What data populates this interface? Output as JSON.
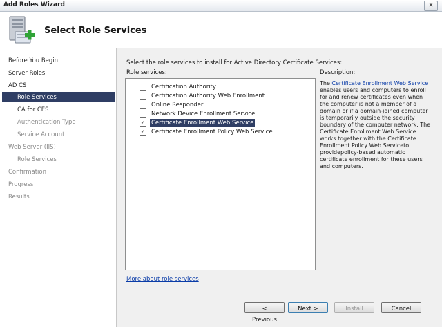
{
  "window": {
    "title": "Add Roles Wizard",
    "close_glyph": "✕"
  },
  "header": {
    "title": "Select Role Services",
    "icon": "server-roles-add-icon"
  },
  "nav": {
    "items": [
      {
        "label": "Before You Begin"
      },
      {
        "label": "Server Roles"
      },
      {
        "label": "AD CS"
      },
      {
        "label": "Role Services"
      },
      {
        "label": "CA for CES"
      },
      {
        "label": "Authentication Type"
      },
      {
        "label": "Service Account"
      },
      {
        "label": "Web Server (IIS)"
      },
      {
        "label": "Role Services"
      },
      {
        "label": "Confirmation"
      },
      {
        "label": "Progress"
      },
      {
        "label": "Results"
      }
    ]
  },
  "main": {
    "instruction": "Select the role services to install for Active Directory Certificate Services:",
    "role_services_label": "Role services:",
    "role_services": [
      {
        "label": "Certification Authority",
        "checked": false
      },
      {
        "label": "Certification Authority Web Enrollment",
        "checked": false
      },
      {
        "label": "Online Responder",
        "checked": false
      },
      {
        "label": "Network Device Enrollment Service",
        "checked": false
      },
      {
        "label": "Certificate Enrollment Web Service",
        "checked": true,
        "selected": true
      },
      {
        "label": "Certificate Enrollment Policy Web Service",
        "checked": true
      }
    ],
    "check_glyph": "✓",
    "description_label": "Description:",
    "description": {
      "prefix": "The ",
      "link": "Certificate Enrollment Web Service",
      "body": " enables users and computers to enroll for and renew certificates even when the computer is not a member of a domain or if a domain-joined computer is temporarily outside the security boundary of the computer network. The Certificate Enrollment Web Service works together with the Certificate Enrollment Policy Web Serviceto providepolicy-based automatic certificate enrollment for these users and computers."
    },
    "more_link": "More about role services"
  },
  "buttons": {
    "previous": "< Previous",
    "next": "Next >",
    "install": "Install",
    "cancel": "Cancel"
  }
}
